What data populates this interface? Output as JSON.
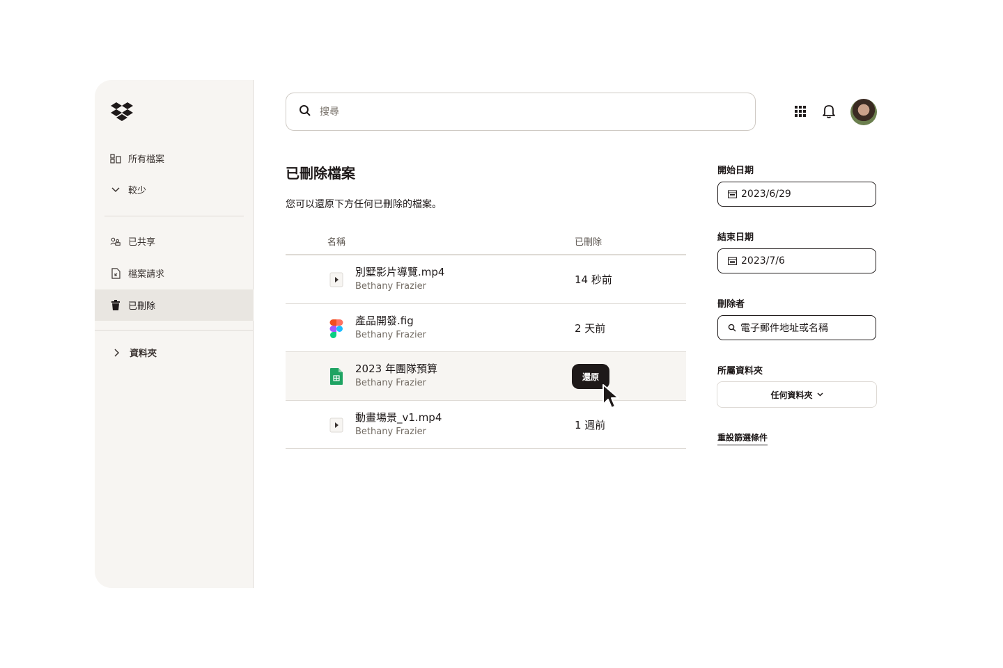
{
  "sidebar": {
    "items": [
      {
        "label": "所有檔案",
        "icon": "all-files-icon"
      },
      {
        "label": "較少",
        "icon": "chevron-down-icon"
      },
      {
        "label": "已共享",
        "icon": "shared-icon"
      },
      {
        "label": "檔案請求",
        "icon": "file-request-icon"
      },
      {
        "label": "已刪除",
        "icon": "trash-icon"
      },
      {
        "label": "資料夾",
        "icon": "chevron-right-icon"
      }
    ]
  },
  "search": {
    "placeholder": "搜尋"
  },
  "main": {
    "title": "已刪除檔案",
    "description": "您可以還原下方任何已刪除的檔案。",
    "table": {
      "headers": {
        "name": "名稱",
        "deleted": "已刪除"
      },
      "rows": [
        {
          "name": "別墅影片導覽.mp4",
          "owner": "Bethany Frazier",
          "deleted": "14 秒前",
          "icon": "video-file-icon"
        },
        {
          "name": "產品開發.fig",
          "owner": "Bethany Frazier",
          "deleted": "2 天前",
          "icon": "figma-file-icon"
        },
        {
          "name": "2023 年團隊預算",
          "owner": "Bethany Frazier",
          "deleted": "",
          "icon": "sheets-file-icon"
        },
        {
          "name": "動畫場景_v1.mp4",
          "owner": "Bethany Frazier",
          "deleted": "1 週前",
          "icon": "video-file-icon"
        }
      ],
      "restore_label": "還原"
    }
  },
  "filters": {
    "start_date": {
      "label": "開始日期",
      "value": "2023/6/29"
    },
    "end_date": {
      "label": "結束日期",
      "value": "2023/7/6"
    },
    "deleted_by": {
      "label": "刪除者",
      "placeholder": "電子郵件地址或名稱"
    },
    "folder": {
      "label": "所屬資料夾",
      "value": "任何資料夾"
    },
    "reset_label": "重設篩選條件"
  },
  "colors": {
    "accent": "#1e1919",
    "sidebar_bg": "#f7f5f2",
    "active_bg": "#e9e6e1",
    "sheets_green": "#1ea362"
  }
}
